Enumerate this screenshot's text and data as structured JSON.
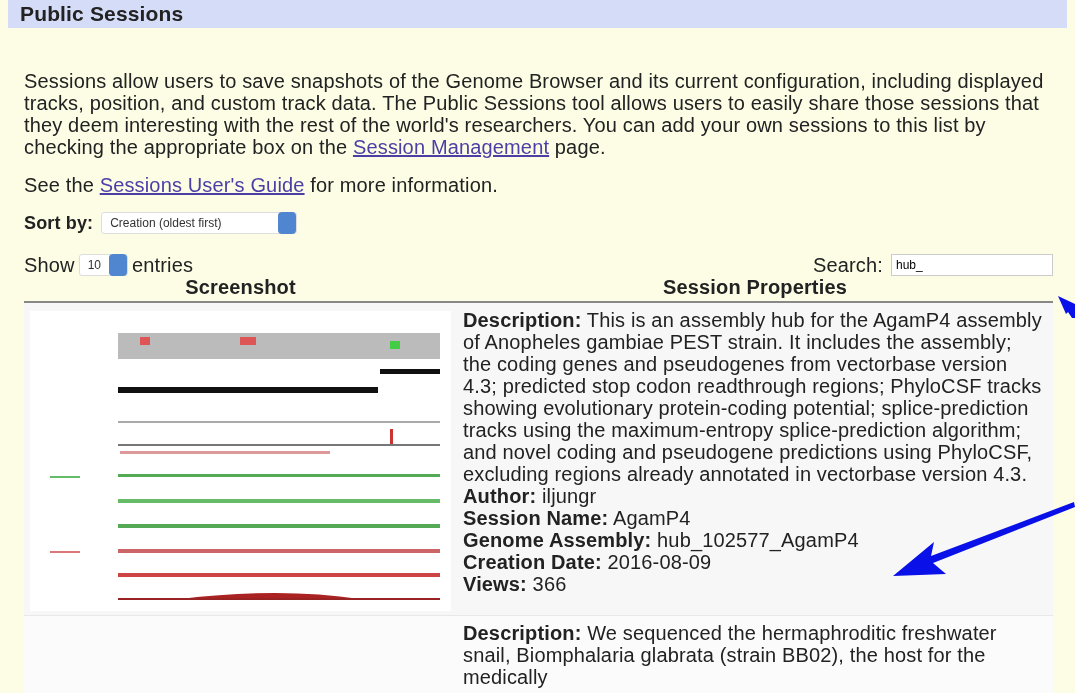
{
  "title": "Public Sessions",
  "intro": "Sessions allow users to save snapshots of the Genome Browser and its current configuration, including displayed tracks, position, and custom track data. The Public Sessions tool allows users to easily share those sessions that they deem interesting with the rest of the world's researchers. You can add your own sessions to this list by checking the appropriate box on the ",
  "intro_link": "Session Management",
  "intro_end": " page.",
  "guide_before": "See the ",
  "guide_link": "Sessions User's Guide",
  "guide_after": " for more information.",
  "sort": {
    "label": "Sort by:",
    "value": "Creation (oldest first)"
  },
  "show": {
    "before": "Show",
    "value": "10",
    "after": "entries"
  },
  "search": {
    "label": "Search:",
    "value": "hub_"
  },
  "table": {
    "columns": [
      "Screenshot",
      "Session Properties"
    ],
    "rows": [
      {
        "properties": [
          "**Description:** This is an assembly hub for the AgamP4 assembly of Anopheles gambiae PEST strain. It includes the assembly; the coding genes and pseudogenes from vectorbase version 4.3; predicted stop codon readthrough regions; PhyloCSF tracks showing evolutionary protein-coding potential; splice-prediction tracks using the maximum-entropy splice-prediction algorithm; and novel coding and pseudogene predictions using PhyloCSF, excluding regions already annotated in vectorbase version 4.3.",
          "**Author:** iljungr",
          "**Session Name:** AgamP4",
          "**Genome Assembly:** hub_102577_AgamP4",
          "**Creation Date:** 2016-08-09",
          "**Views:** 366"
        ]
      },
      {
        "properties": [
          "**Description:** We sequenced the hermaphroditic freshwater snail, Biomphalaria glabrata (strain BB02), the host for the medically"
        ]
      }
    ]
  }
}
